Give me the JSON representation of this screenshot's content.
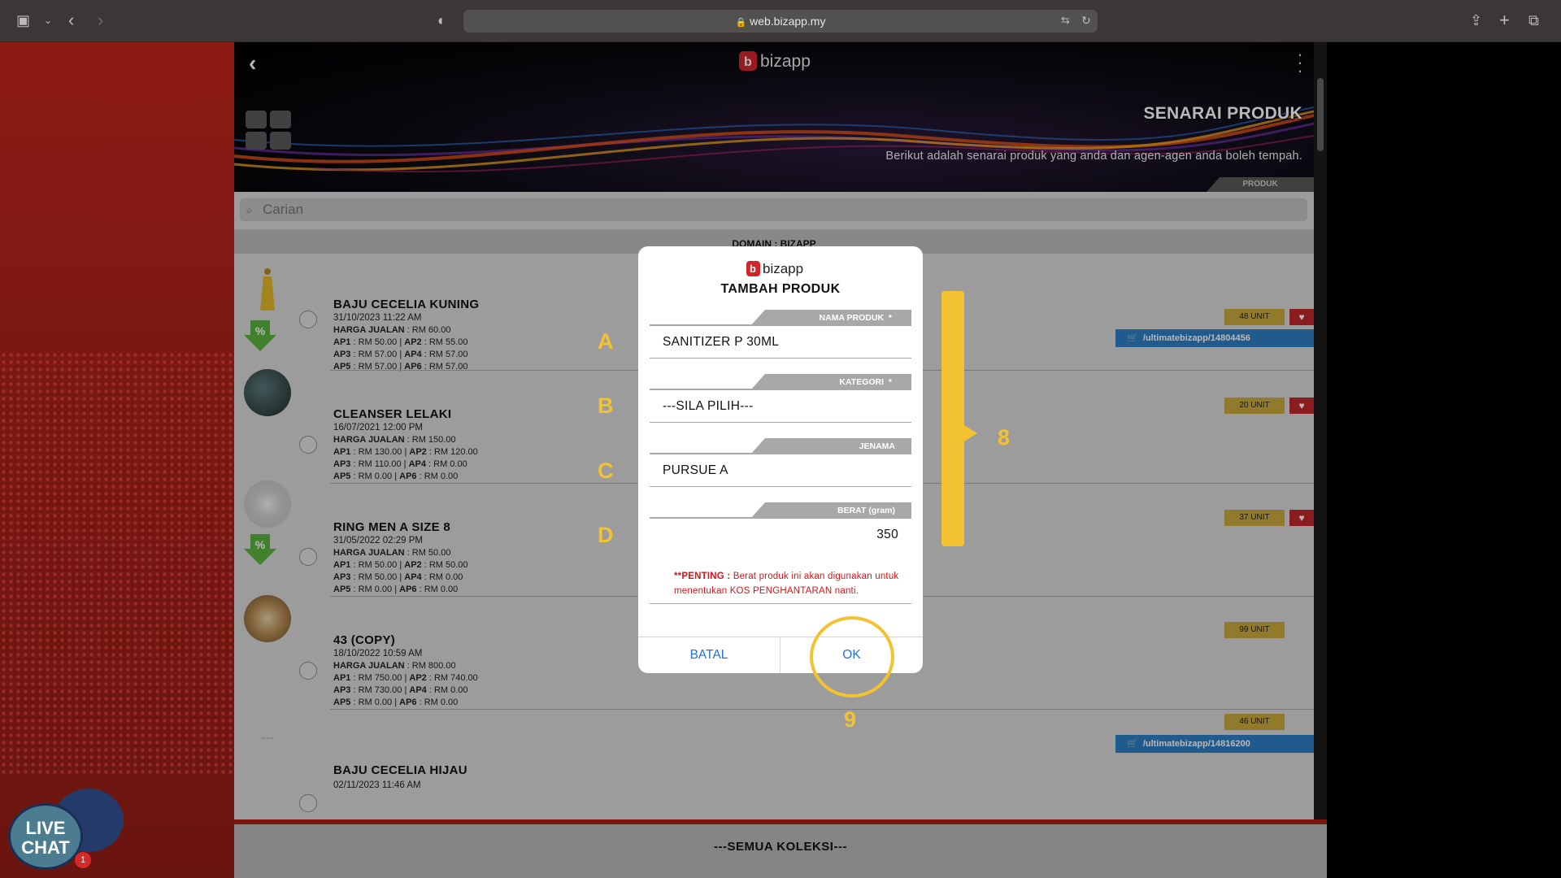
{
  "browser": {
    "url": "web.bizapp.my"
  },
  "header": {
    "logo_text": "bizapp",
    "title": "SENARAI PRODUK",
    "subtitle": "Berikut adalah senarai produk yang anda dan agen-agen anda boleh tempah.",
    "breadcrumb": "PRODUK"
  },
  "search": {
    "placeholder": "Carian"
  },
  "domain_label": "DOMAIN : BIZAPP",
  "products": [
    {
      "name": "BAJU CECELIA KUNING",
      "date": "31/10/2023 11:22 AM",
      "harga_label": "HARGA JUALAN",
      "harga": "RM 60.00",
      "ap1": "RM 50.00",
      "ap2": "RM 55.00",
      "ap3": "RM 57.00",
      "ap4": "RM 57.00",
      "ap5": "RM 57.00",
      "ap6": "RM 57.00",
      "stock": "48 UNIT",
      "link": "/ultimatebizapp/14804456"
    },
    {
      "name": "CLEANSER LELAKI",
      "date": "16/07/2021 12:00 PM",
      "harga_label": "HARGA JUALAN",
      "harga": "RM 150.00",
      "ap1": "RM 130.00",
      "ap2": "RM 120.00",
      "ap3": "RM 110.00",
      "ap4": "RM 0.00",
      "ap5": "RM 0.00",
      "ap6": "RM 0.00",
      "stock": "20 UNIT"
    },
    {
      "name": "RING MEN A SIZE 8",
      "date": "31/05/2022 02:29 PM",
      "harga_label": "HARGA JUALAN",
      "harga": "RM 50.00",
      "ap1": "RM 50.00",
      "ap2": "RM 50.00",
      "ap3": "RM 50.00",
      "ap4": "RM 0.00",
      "ap5": "RM 0.00",
      "ap6": "RM 0.00",
      "stock": "37 UNIT"
    },
    {
      "name": "43 (COPY)",
      "date": "18/10/2022 10:59 AM",
      "harga_label": "HARGA JUALAN",
      "harga": "RM 800.00",
      "ap1": "RM 750.00",
      "ap2": "RM 740.00",
      "ap3": "RM 730.00",
      "ap4": "RM 0.00",
      "ap5": "RM 0.00",
      "ap6": "RM 0.00",
      "stock": "99 UNIT"
    },
    {
      "name": "BAJU CECELIA HIJAU",
      "date": "02/11/2023 11:46 AM",
      "stock": "46 UNIT",
      "link": "/ultimatebizapp/14816200"
    }
  ],
  "footer": "---SEMUA KOLEKSI---",
  "modal": {
    "logo_text": "bizapp",
    "title": "TAMBAH PRODUK",
    "fields": [
      {
        "label": "NAMA PRODUK",
        "required": "*",
        "value": "SANITIZER P 30ML"
      },
      {
        "label": "KATEGORI",
        "required": "*",
        "value": "---SILA PILIH---"
      },
      {
        "label": "JENAMA",
        "required": "",
        "value": "PURSUE A"
      },
      {
        "label": "BERAT (gram)",
        "required": "",
        "value": "350"
      }
    ],
    "note_strong": "**PENTING :",
    "note_text": "Berat produk ini akan digunakan untuk menentukan KOS PENGHANTARAN nanti.",
    "cancel": "BATAL",
    "ok": "OK"
  },
  "annotations": {
    "a": "A",
    "b": "B",
    "c": "C",
    "d": "D",
    "eight": "8",
    "nine": "9"
  },
  "livechat": {
    "line1": "LIVE",
    "line2": "CHAT",
    "badge": "1"
  },
  "colors": {
    "accent_yellow": "#f2c230",
    "link_blue": "#2a6fcf",
    "stock_gold": "#c9a93d",
    "heart_red": "#c0272d",
    "brand_red": "#b01e16"
  }
}
